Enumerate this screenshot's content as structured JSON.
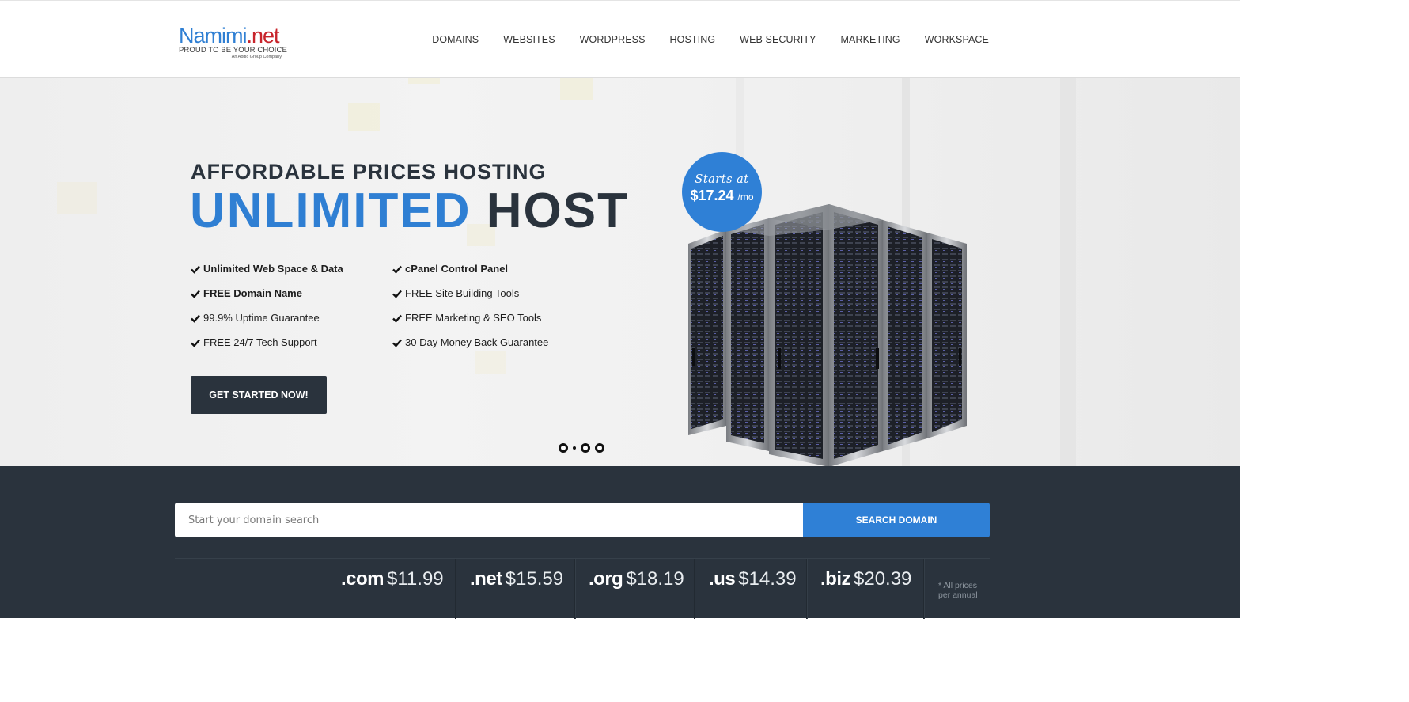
{
  "logo": {
    "name_part1": "Namimi",
    "name_part2": ".net",
    "tagline": "PROUD TO BE YOUR CHOICE",
    "subline": "An Abitic Group Company"
  },
  "nav": {
    "items": [
      "DOMAINS",
      "WEBSITES",
      "WORDPRESS",
      "HOSTING",
      "WEB SECURITY",
      "MARKETING",
      "WORKSPACE"
    ]
  },
  "hero": {
    "subtitle": "AFFORDABLE PRICES HOSTING",
    "title_highlight": "UNLIMITED",
    "title_rest": "HOST",
    "features": [
      {
        "label": "Unlimited Web Space & Data",
        "bold": true
      },
      {
        "label": "cPanel Control Panel",
        "bold": true
      },
      {
        "label": "FREE Domain Name",
        "bold": true
      },
      {
        "label": "FREE Site Building Tools",
        "bold": false
      },
      {
        "label": "99.9% Uptime Guarantee",
        "bold": false
      },
      {
        "label": "FREE Marketing & SEO Tools",
        "bold": false
      },
      {
        "label": "FREE 24/7 Tech Support",
        "bold": false
      },
      {
        "label": "30 Day Money Back Guarantee",
        "bold": false
      }
    ],
    "cta_label": "GET STARTED NOW!",
    "badge": {
      "top": "Starts at",
      "price": "$17.24",
      "unit": "/mo"
    },
    "slider_dots": 4
  },
  "domain_search": {
    "placeholder": "Start your domain search",
    "button_label": "SEARCH DOMAIN",
    "tlds": [
      {
        "ext": ".com",
        "price": "$11.99"
      },
      {
        "ext": ".net",
        "price": "$15.59"
      },
      {
        "ext": ".org",
        "price": "$18.19"
      },
      {
        "ext": ".us",
        "price": "$14.39"
      },
      {
        "ext": ".biz",
        "price": "$20.39"
      }
    ],
    "note_line1": "* All prices",
    "note_line2": "per annual"
  },
  "colors": {
    "accent": "#2f80d6",
    "dark": "#2a333d",
    "logo_red": "#c8242b"
  }
}
